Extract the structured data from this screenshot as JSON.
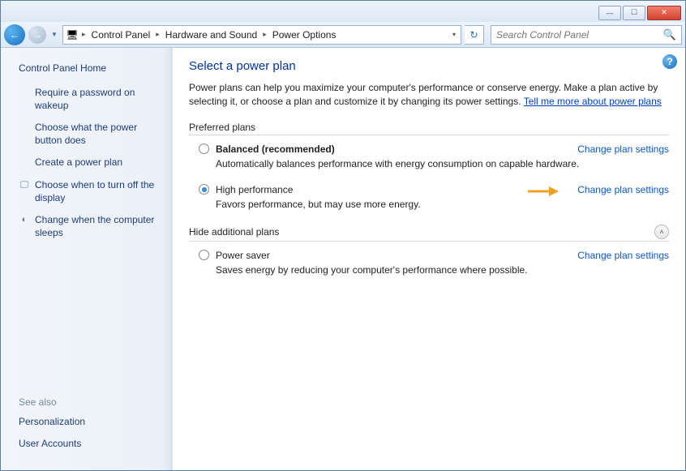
{
  "window": {
    "minimize_glyph": "―",
    "maximize_glyph": "☐",
    "close_glyph": "✕"
  },
  "nav": {
    "back_glyph": "←",
    "forward_glyph": "→",
    "dropdown_glyph": "▼",
    "refresh_glyph": "↻"
  },
  "breadcrumb": {
    "icon_glyph": "🖥",
    "items": [
      "Control Panel",
      "Hardware and Sound",
      "Power Options"
    ],
    "sep": "▸",
    "end_dd": "▾",
    "search_placeholder": "Search Control Panel",
    "search_glyph": "🔍"
  },
  "sidebar": {
    "home": "Control Panel Home",
    "links": [
      {
        "label": "Require a password on wakeup",
        "icon": ""
      },
      {
        "label": "Choose what the power button does",
        "icon": ""
      },
      {
        "label": "Create a power plan",
        "icon": ""
      },
      {
        "label": "Choose when to turn off the display",
        "icon": "🖵"
      },
      {
        "label": "Change when the computer sleeps",
        "icon": "◐"
      }
    ],
    "see_also_heading": "See also",
    "see_also": [
      "Personalization",
      "User Accounts"
    ]
  },
  "main": {
    "help_glyph": "?",
    "title": "Select a power plan",
    "intro_text": "Power plans can help you maximize your computer's performance or conserve energy. Make a plan active by selecting it, or choose a plan and customize it by changing its power settings. ",
    "intro_link": "Tell me more about power plans",
    "preferred_heading": "Preferred plans",
    "hide_heading": "Hide additional plans",
    "expand_glyph": "˄",
    "plans_preferred": [
      {
        "name": "Balanced (recommended)",
        "bold": true,
        "checked": false,
        "desc": "Automatically balances performance with energy consumption on capable hardware.",
        "link": "Change plan settings"
      },
      {
        "name": "High performance",
        "bold": false,
        "checked": true,
        "desc": "Favors performance, but may use more energy.",
        "link": "Change plan settings",
        "highlighted": true
      }
    ],
    "plans_additional": [
      {
        "name": "Power saver",
        "bold": false,
        "checked": false,
        "desc": "Saves energy by reducing your computer's performance where possible.",
        "link": "Change plan settings"
      }
    ]
  }
}
